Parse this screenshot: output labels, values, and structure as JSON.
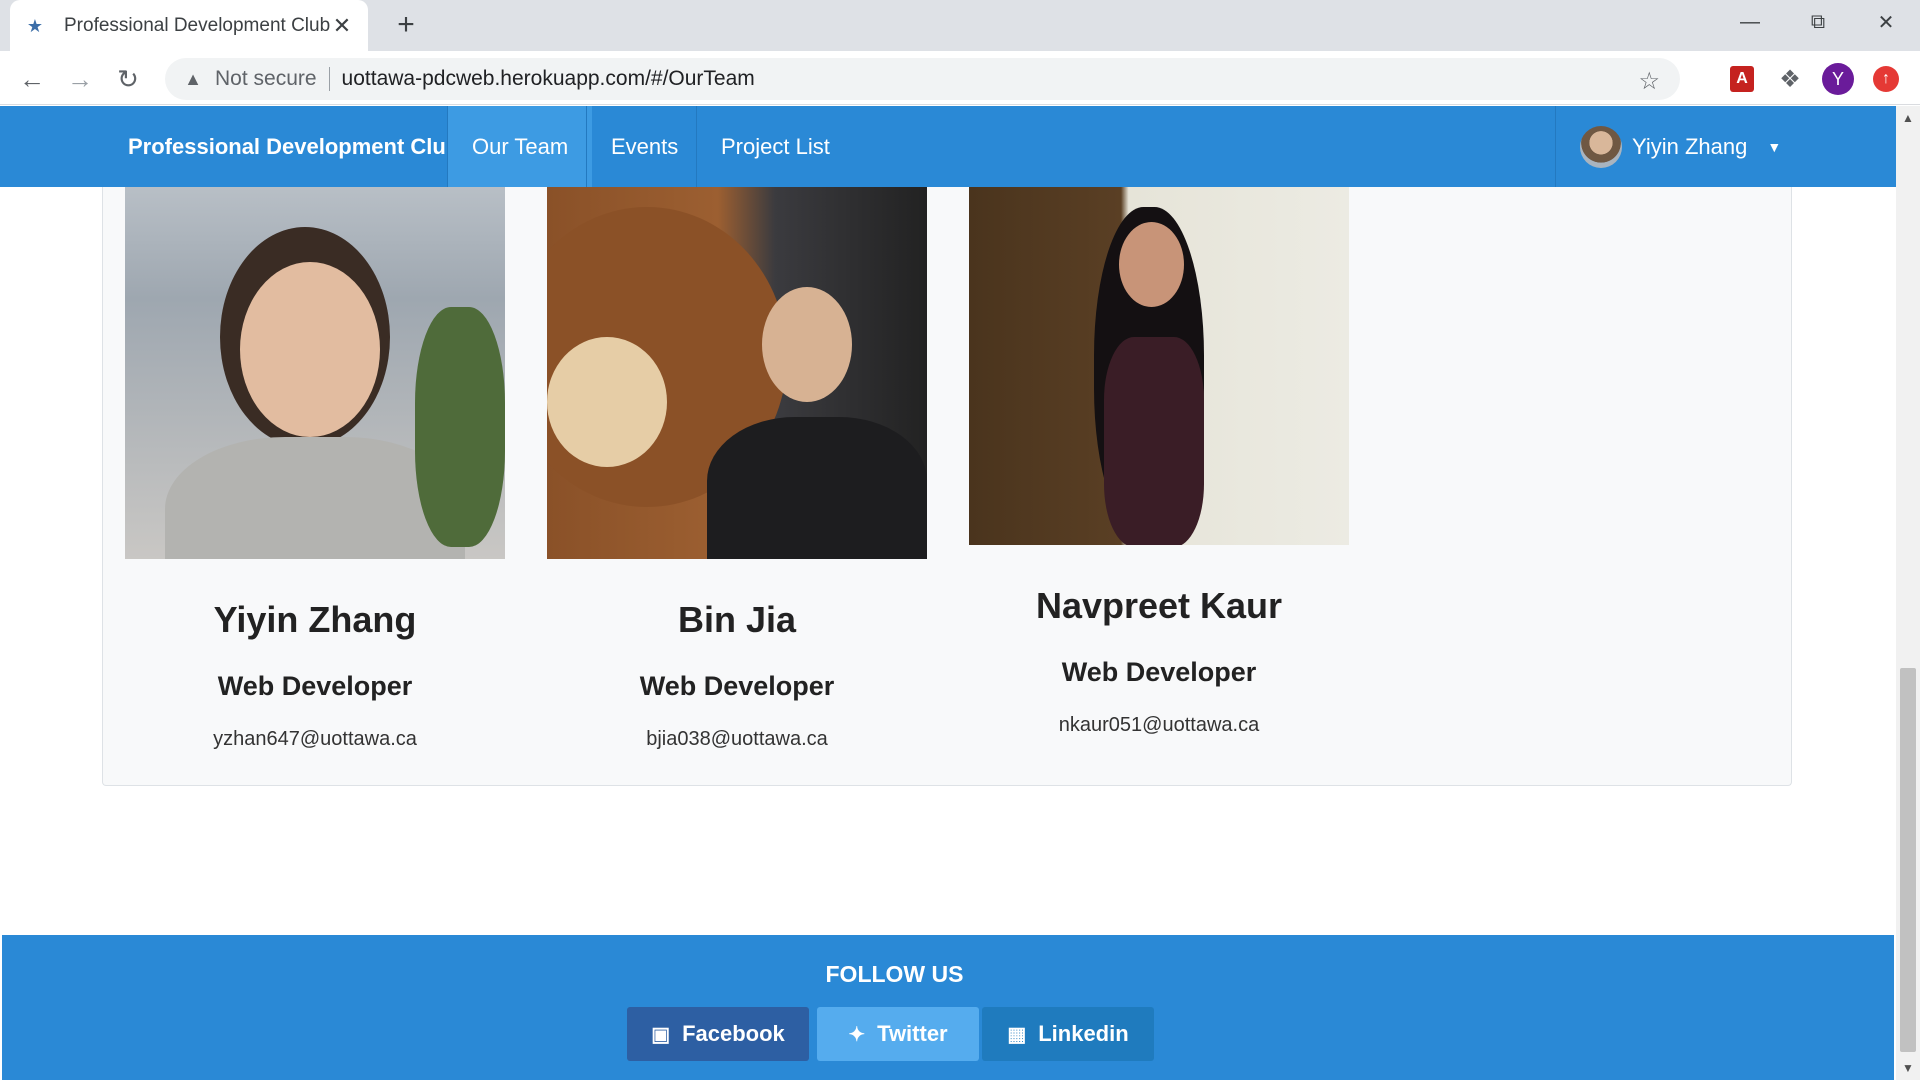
{
  "browser": {
    "tab_title": "Professional Development Club",
    "security_label": "Not secure",
    "url": "uottawa-pdcweb.herokuapp.com/#/OurTeam",
    "profile_initial": "Y"
  },
  "navbar": {
    "brand": "Professional Development Club",
    "items": [
      {
        "label": "Our Team",
        "active": true
      },
      {
        "label": "Events",
        "active": false
      },
      {
        "label": "Project List",
        "active": false
      }
    ],
    "user_name": "Yiyin Zhang"
  },
  "team": {
    "members": [
      {
        "name": "Yiyin Zhang",
        "role": "Web Developer",
        "email": "yzhan647@uottawa.ca"
      },
      {
        "name": "Bin Jia",
        "role": "Web Developer",
        "email": "bjia038@uottawa.ca"
      },
      {
        "name": "Navpreet Kaur",
        "role": "Web Developer",
        "email": "nkaur051@uottawa.ca"
      }
    ]
  },
  "footer": {
    "heading": "FOLLOW US",
    "buttons": [
      {
        "label": "Facebook",
        "icon": "facebook-icon"
      },
      {
        "label": "Twitter",
        "icon": "twitter-icon"
      },
      {
        "label": "Linkedin",
        "icon": "linkedin-icon"
      }
    ]
  },
  "colors": {
    "primary": "#2a89d6",
    "active_nav": "#3d9be3",
    "facebook": "#2d5fa3",
    "twitter": "#55acee",
    "linkedin": "#1f7bbe"
  }
}
